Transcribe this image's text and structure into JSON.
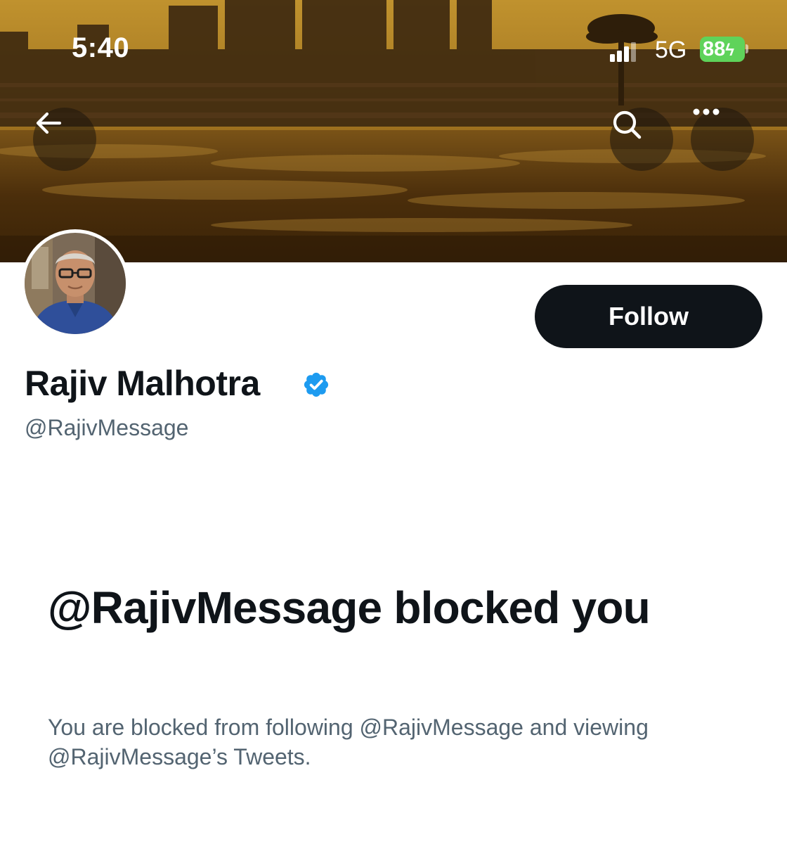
{
  "status_bar": {
    "time": "5:40",
    "network": "5G",
    "battery": "88"
  },
  "header": {
    "back_icon": "arrow-left-icon",
    "search_icon": "search-icon",
    "more_icon": "more-horizontal-icon"
  },
  "profile": {
    "display_name": "Rajiv Malhotra",
    "handle": "@RajivMessage",
    "verified": true,
    "verified_color": "#1d9bf0",
    "follow_label": "Follow"
  },
  "blocked": {
    "title": "@RajivMessage blocked you",
    "description": "You are blocked from following @RajivMessage and viewing @RajivMessage’s Tweets."
  },
  "colors": {
    "text_primary": "#0f1419",
    "text_secondary": "#536471",
    "button_dark": "#0f1419",
    "battery_green": "#5fd35a"
  }
}
